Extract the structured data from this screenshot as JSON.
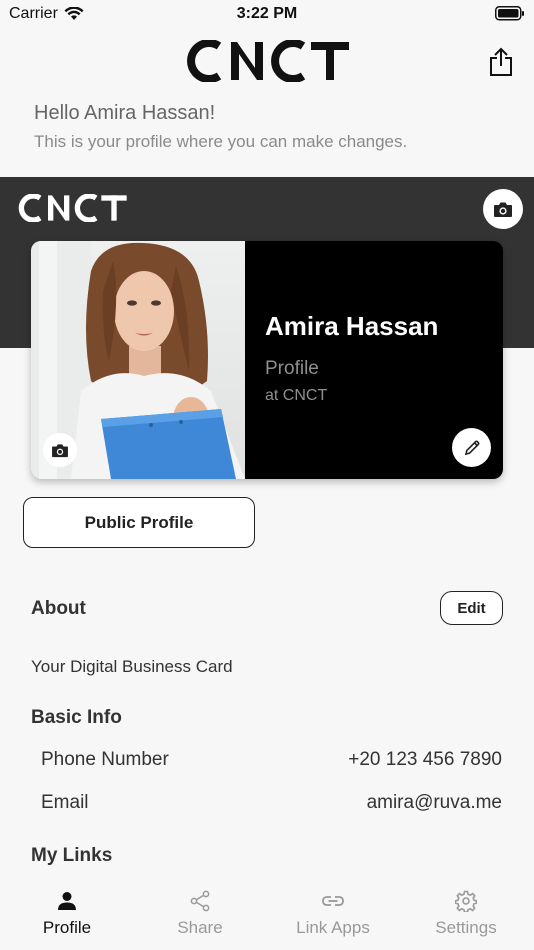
{
  "status_bar": {
    "carrier": "Carrier",
    "time": "3:22 PM"
  },
  "header": {
    "logo": "CNCT"
  },
  "greeting": {
    "hello": "Hello  Amira Hassan!",
    "subtitle": "This is your profile where you can make changes."
  },
  "card": {
    "band_logo": "CNCT",
    "name": "Amira Hassan",
    "title": "Profile",
    "company": "at CNCT"
  },
  "public_profile_label": "Public Profile",
  "about": {
    "heading": "About",
    "edit_label": "Edit",
    "text": "Your Digital Business Card"
  },
  "basic_info": {
    "heading": "Basic Info",
    "rows": [
      {
        "label": "Phone Number",
        "value": "+20 123 456 7890"
      },
      {
        "label": "Email",
        "value": "amira@ruva.me"
      }
    ]
  },
  "links": {
    "heading": "My Links"
  },
  "tabs": [
    {
      "label": "Profile",
      "icon": "person-icon",
      "active": true
    },
    {
      "label": "Share",
      "icon": "share-nodes-icon",
      "active": false
    },
    {
      "label": "Link Apps",
      "icon": "link-icon",
      "active": false
    },
    {
      "label": "Settings",
      "icon": "gear-icon",
      "active": false
    }
  ],
  "colors": {
    "band": "#333333",
    "card_bg": "#000000",
    "accent_text": "#111111",
    "muted": "#999999"
  }
}
